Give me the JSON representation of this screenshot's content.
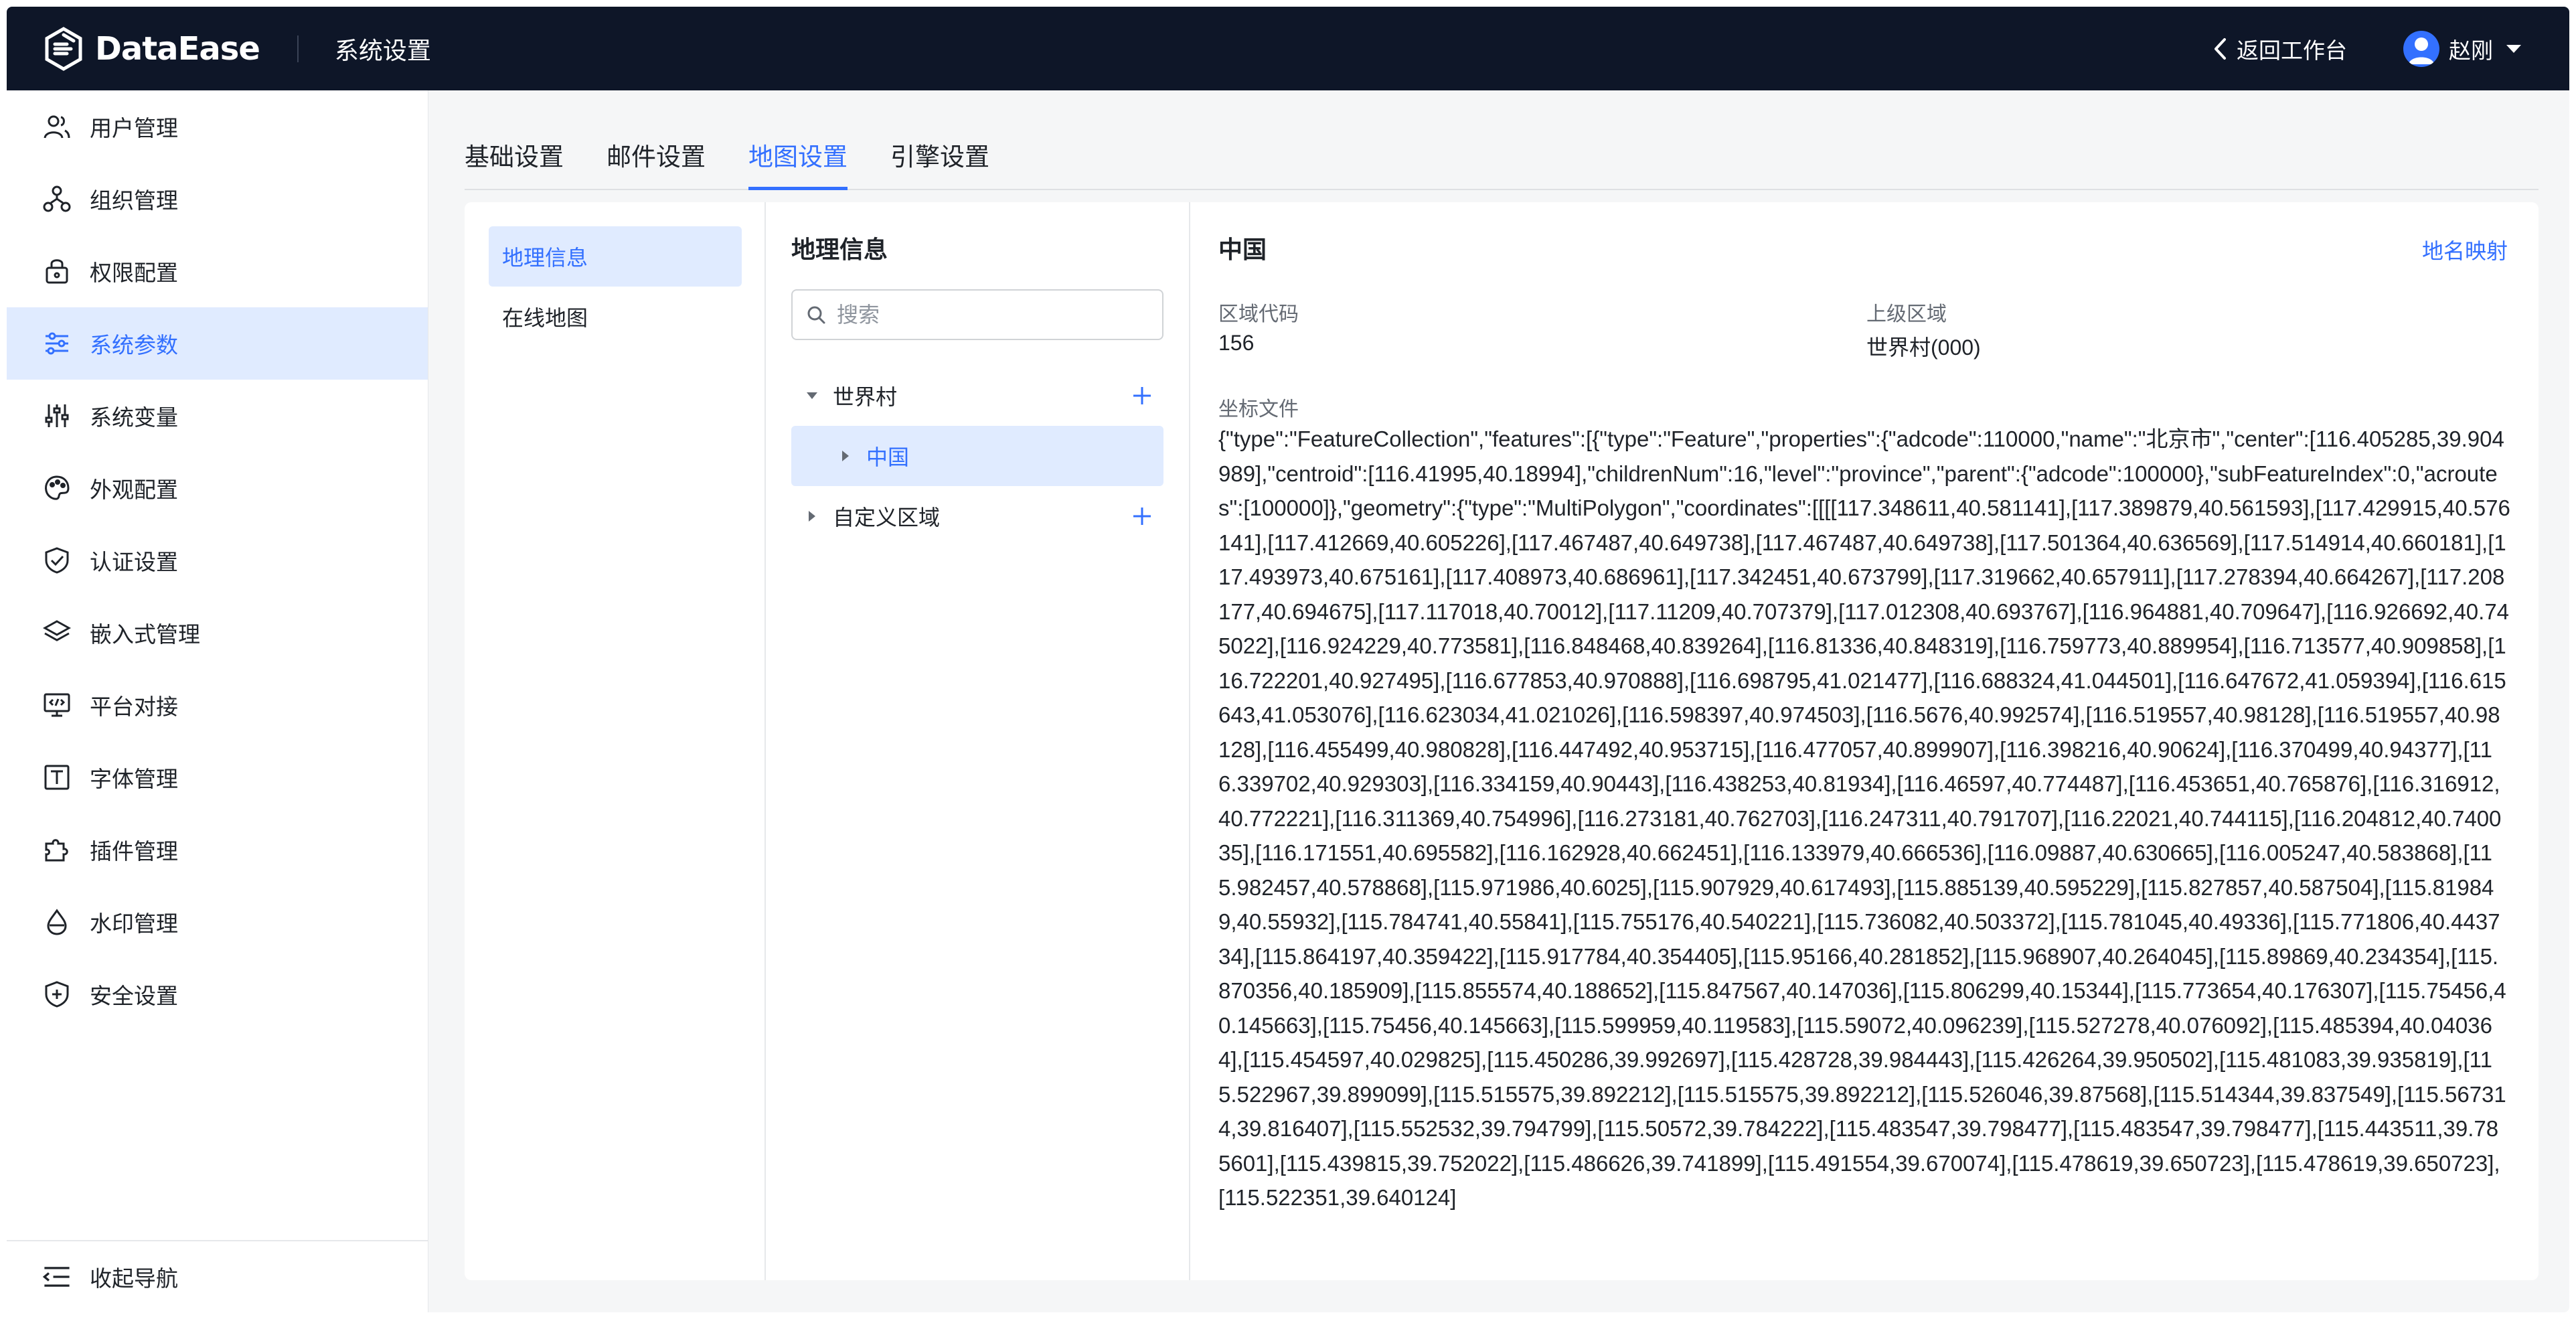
{
  "header": {
    "logo_text": "DataEase",
    "section_title": "系统设置",
    "back_label": "返回工作台",
    "user_name": "赵刚"
  },
  "sidebar": {
    "items": [
      {
        "label": "用户管理",
        "icon": "users-icon"
      },
      {
        "label": "组织管理",
        "icon": "org-tree-icon"
      },
      {
        "label": "权限配置",
        "icon": "lock-icon"
      },
      {
        "label": "系统参数",
        "icon": "sliders-icon",
        "active": true
      },
      {
        "label": "系统变量",
        "icon": "variables-icon"
      },
      {
        "label": "外观配置",
        "icon": "palette-icon"
      },
      {
        "label": "认证设置",
        "icon": "shield-check-icon"
      },
      {
        "label": "嵌入式管理",
        "icon": "layers-icon"
      },
      {
        "label": "平台对接",
        "icon": "monitor-code-icon"
      },
      {
        "label": "字体管理",
        "icon": "font-icon"
      },
      {
        "label": "插件管理",
        "icon": "puzzle-icon"
      },
      {
        "label": "水印管理",
        "icon": "droplet-icon"
      },
      {
        "label": "安全设置",
        "icon": "shield-plus-icon"
      }
    ],
    "footer_label": "收起导航"
  },
  "tabs": [
    {
      "label": "基础设置"
    },
    {
      "label": "邮件设置"
    },
    {
      "label": "地图设置",
      "active": true
    },
    {
      "label": "引擎设置"
    }
  ],
  "submenu": {
    "items": [
      {
        "label": "地理信息",
        "active": true
      },
      {
        "label": "在线地图"
      }
    ]
  },
  "geo_panel": {
    "title": "地理信息",
    "search_placeholder": "搜索",
    "tree": [
      {
        "label": "世界村",
        "expanded": true
      },
      {
        "label": "中国",
        "active": true
      },
      {
        "label": "自定义区域",
        "expanded": false
      }
    ]
  },
  "detail": {
    "title": "中国",
    "map_link": "地名映射",
    "area_code_label": "区域代码",
    "area_code": "156",
    "parent_label": "上级区域",
    "parent_value": "世界村(000)",
    "coord_label": "坐标文件",
    "coord_text": "{\"type\":\"FeatureCollection\",\"features\":[{\"type\":\"Feature\",\"properties\":{\"adcode\":110000,\"name\":\"北京市\",\"center\":[116.405285,39.904989],\"centroid\":[116.41995,40.18994],\"childrenNum\":16,\"level\":\"province\",\"parent\":{\"adcode\":100000},\"subFeatureIndex\":0,\"acroutes\":[100000]},\"geometry\":{\"type\":\"MultiPolygon\",\"coordinates\":[[[[117.348611,40.581141],[117.389879,40.561593],[117.429915,40.576141],[117.412669,40.605226],[117.467487,40.649738],[117.467487,40.649738],[117.501364,40.636569],[117.514914,40.660181],[117.493973,40.675161],[117.408973,40.686961],[117.342451,40.673799],[117.319662,40.657911],[117.278394,40.664267],[117.208177,40.694675],[117.117018,40.70012],[117.11209,40.707379],[117.012308,40.693767],[116.964881,40.709647],[116.926692,40.745022],[116.924229,40.773581],[116.848468,40.839264],[116.81336,40.848319],[116.759773,40.889954],[116.713577,40.909858],[116.722201,40.927495],[116.677853,40.970888],[116.698795,41.021477],[116.688324,41.044501],[116.647672,41.059394],[116.615643,41.053076],[116.623034,41.021026],[116.598397,40.974503],[116.5676,40.992574],[116.519557,40.98128],[116.519557,40.98128],[116.455499,40.980828],[116.447492,40.953715],[116.477057,40.899907],[116.398216,40.90624],[116.370499,40.94377],[116.339702,40.929303],[116.334159,40.90443],[116.438253,40.81934],[116.46597,40.774487],[116.453651,40.765876],[116.316912,40.772221],[116.311369,40.754996],[116.273181,40.762703],[116.247311,40.791707],[116.22021,40.744115],[116.204812,40.740035],[116.171551,40.695582],[116.162928,40.662451],[116.133979,40.666536],[116.09887,40.630665],[116.005247,40.583868],[115.982457,40.578868],[115.971986,40.6025],[115.907929,40.617493],[115.885139,40.595229],[115.827857,40.587504],[115.819849,40.55932],[115.784741,40.55841],[115.755176,40.540221],[115.736082,40.503372],[115.781045,40.49336],[115.771806,40.443734],[115.864197,40.359422],[115.917784,40.354405],[115.95166,40.281852],[115.968907,40.264045],[115.89869,40.234354],[115.870356,40.185909],[115.855574,40.188652],[115.847567,40.147036],[115.806299,40.15344],[115.773654,40.176307],[115.75456,40.145663],[115.75456,40.145663],[115.599959,40.119583],[115.59072,40.096239],[115.527278,40.076092],[115.485394,40.040364],[115.454597,40.029825],[115.450286,39.992697],[115.428728,39.984443],[115.426264,39.950502],[115.481083,39.935819],[115.522967,39.899099],[115.515575,39.892212],[115.515575,39.892212],[115.526046,39.87568],[115.514344,39.837549],[115.567314,39.816407],[115.552532,39.794799],[115.50572,39.784222],[115.483547,39.798477],[115.483547,39.798477],[115.443511,39.785601],[115.439815,39.752022],[115.486626,39.741899],[115.491554,39.670074],[115.478619,39.650723],[115.478619,39.650723],[115.522351,39.640124]"
  }
}
